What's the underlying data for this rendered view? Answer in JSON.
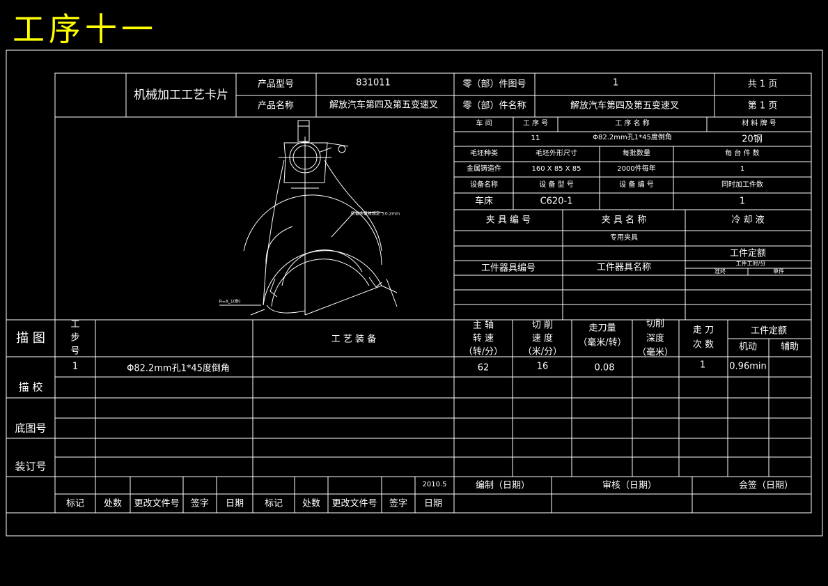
{
  "page_title": "工序十一",
  "header": {
    "card_title": "机械加工工艺卡片",
    "product_model_label": "产品型号",
    "product_model": "831011",
    "part_drawing_no_label": "零（部）件图号",
    "part_drawing_no": "1",
    "total_pages": "共  1  页",
    "product_name_label": "产品名称",
    "product_name": "解放汽车第四及第五变速叉",
    "part_name_label": "零（部）件名称",
    "part_name": "解放汽车第四及第五变速叉",
    "page_no": "第  1  页"
  },
  "process": {
    "workshop_label": "车  间",
    "process_no_label": "工 序 号",
    "process_name_label": "工  序  名  称",
    "material_label": "材 料 牌 号",
    "process_no": "11",
    "process_name": "Φ82.2mm孔1*45度倒角",
    "material": "20钢",
    "blank_type_label": "毛坯种类",
    "blank_size_label": "毛坯外形尺寸",
    "batch_label": "每批数量",
    "per_unit_label": "每 台 件 数",
    "blank_type": "金属铸造件",
    "blank_size": "160 X 85 X 85",
    "batch": "2000件每年",
    "per_unit": "1",
    "equipment_name_label": "设备名称",
    "equipment_model_label": "设 备 型 号",
    "equipment_no_label": "设 备 编 号",
    "simultaneous_label": "同时加工件数",
    "equipment_name": "车床",
    "equipment_model": "C620-1",
    "equipment_no": "",
    "simultaneous": "1",
    "fixture_no_label": "夹 具 编 号",
    "fixture_name_label": "夹 具 名 称",
    "coolant_label": "冷  却  液",
    "fixture_name": "专用夹具",
    "time_quota_label": "工件定额",
    "tool_no_label": "工件器具编号",
    "tool_name_label": "工件器具名称",
    "time_unit_label": "工件工时/分",
    "prep_label": "准终",
    "single_label": "单件"
  },
  "drawing": {
    "note_right": "所留余量按规定 ±0.2mm",
    "note_left": "R=A_1(参)"
  },
  "steps": {
    "side_draw": "描  图",
    "side_check": "描  校",
    "side_base_no": "底图号",
    "side_binding_no": "装订号",
    "step_no_label": "工\n步\n号",
    "equipment_label": "工  艺  装  备",
    "spindle_label_1": "主    轴",
    "spindle_label_2": "转    速",
    "spindle_label_3": "（转/分）",
    "cut_speed_label_1": "切    削",
    "cut_speed_label_2": "速    度",
    "cut_speed_label_3": "（米/分）",
    "feed_label_1": "走刀量",
    "feed_label_2": "（毫米/转）",
    "depth_label_1": "切削",
    "depth_label_2": "深度",
    "depth_label_3": "（毫米）",
    "passes_label_1": "走    刀",
    "passes_label_2": "次    数",
    "quota_label": "工件定额",
    "machine_label": "机动",
    "aux_label": "辅助",
    "rows": [
      {
        "no": "1",
        "content": "Φ82.2mm孔1*45度倒角",
        "spindle": "62",
        "speed": "16",
        "feed": "0.08",
        "depth": "",
        "passes": "1",
        "machine": "0.96min",
        "aux": ""
      }
    ]
  },
  "footer": {
    "date": "2010.5",
    "compiled": "编制（日期）",
    "reviewed": "审核（日期）",
    "countersign": "会签（日期）",
    "mark": "标记",
    "count": "处数",
    "change_doc": "更改文件号",
    "sign": "签字",
    "day": "日期"
  }
}
